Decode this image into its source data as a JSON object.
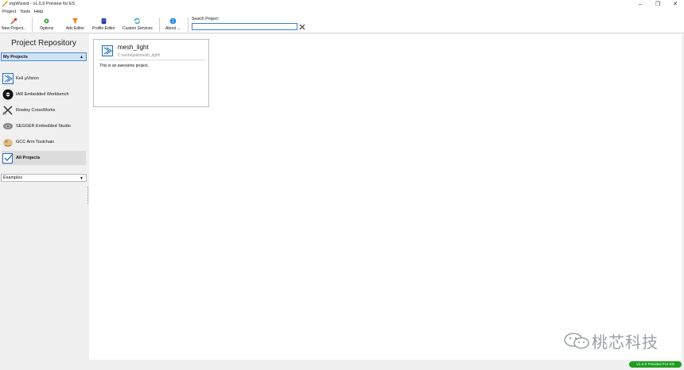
{
  "window": {
    "title": "ingWizard - v1.0.9 Preview for ES",
    "controls": {
      "minimize": "–",
      "restore": "❐",
      "close": "✕"
    }
  },
  "menu": {
    "items": [
      "Project",
      "Tools",
      "Help"
    ]
  },
  "toolbar": {
    "buttons": [
      {
        "label": "New Project...",
        "icon": "new-project-icon"
      },
      {
        "label": "Options",
        "icon": "options-icon"
      },
      {
        "label": "Adv Editor",
        "icon": "adv-editor-icon"
      },
      {
        "label": "Profile Editor",
        "icon": "profile-editor-icon"
      },
      {
        "label": "Custom Services",
        "icon": "custom-services-icon"
      },
      {
        "label": "About ...",
        "icon": "info-icon"
      }
    ],
    "search": {
      "label": "Search Project:",
      "value": "",
      "placeholder": ""
    }
  },
  "sidebar": {
    "title": "Project Repository",
    "group_select": "My Projects",
    "items": [
      {
        "label": "Keil µVision",
        "icon": "keil-icon"
      },
      {
        "label": "IAR Embedded Workbench",
        "icon": "iar-icon"
      },
      {
        "label": "Rowley CrossWorks",
        "icon": "rowley-icon"
      },
      {
        "label": "SEGGER Embedded Studio",
        "icon": "segger-icon"
      },
      {
        "label": "GCC Arm Toolchain",
        "icon": "gcc-icon"
      },
      {
        "label": "All Projects",
        "icon": "all-projects-icon",
        "selected": true
      }
    ],
    "examples_select": "Examples"
  },
  "main": {
    "projects": [
      {
        "name": "mesh_light",
        "path": "C:\\work\\pak\\mesh_light\\",
        "description": "This is an awesome project."
      }
    ]
  },
  "watermark": {
    "text": "桃芯科技"
  },
  "statusbar": {
    "version": "v1.3.0 Preview For ES"
  },
  "colors": {
    "accent": "#3c7fd9",
    "selected_bg": "#cfe3f6",
    "badge": "#1f9d1f"
  }
}
